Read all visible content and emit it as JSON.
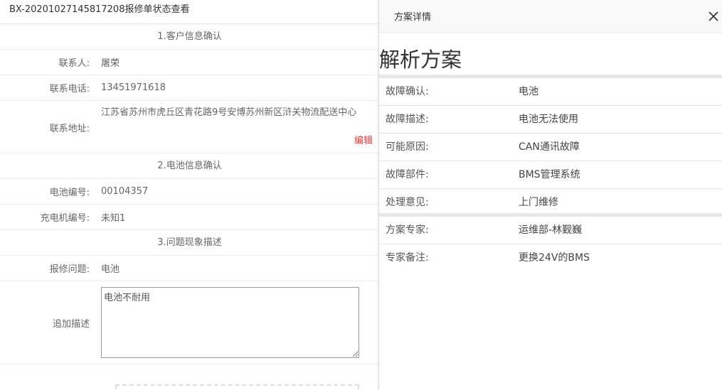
{
  "left": {
    "header_title": "BX-20201027145817208报修单状态查看",
    "section1_title": "1.客户信息确认",
    "contact_label": "联系人:",
    "contact_value": "屠荣",
    "phone_label": "联系电话:",
    "phone_value": "13451971618",
    "address_label": "联系地址:",
    "address_value": "江苏省苏州市虎丘区青花路9号安博苏州新区浒关物流配送中心",
    "edit_label": "编辑",
    "section2_title": "2.电池信息确认",
    "battery_label": "电池编号:",
    "battery_value": "00104357",
    "charger_label": "充电机编号:",
    "charger_value": "未知1",
    "section3_title": "3.问题现象描述",
    "issue_label": "报修问题:",
    "issue_value": "电池",
    "extra_label": "追加描述",
    "extra_value": "电池不耐用"
  },
  "panel": {
    "head_title": "方案详情",
    "title": "解析方案",
    "rows": [
      {
        "key": "故障确认:",
        "value": "电池"
      },
      {
        "key": "故障描述:",
        "value": "电池无法使用"
      },
      {
        "key": "可能原因:",
        "value": "CAN通讯故障"
      },
      {
        "key": "故障部件:",
        "value": "BMS管理系统"
      },
      {
        "key": "处理意见:",
        "value": "上门维修"
      },
      {
        "key": "方案专家:",
        "value": "运维部-林觐巍"
      },
      {
        "key": "专家备注:",
        "value": "更换24V的BMS"
      }
    ]
  },
  "icons": {
    "close": "close-icon"
  }
}
